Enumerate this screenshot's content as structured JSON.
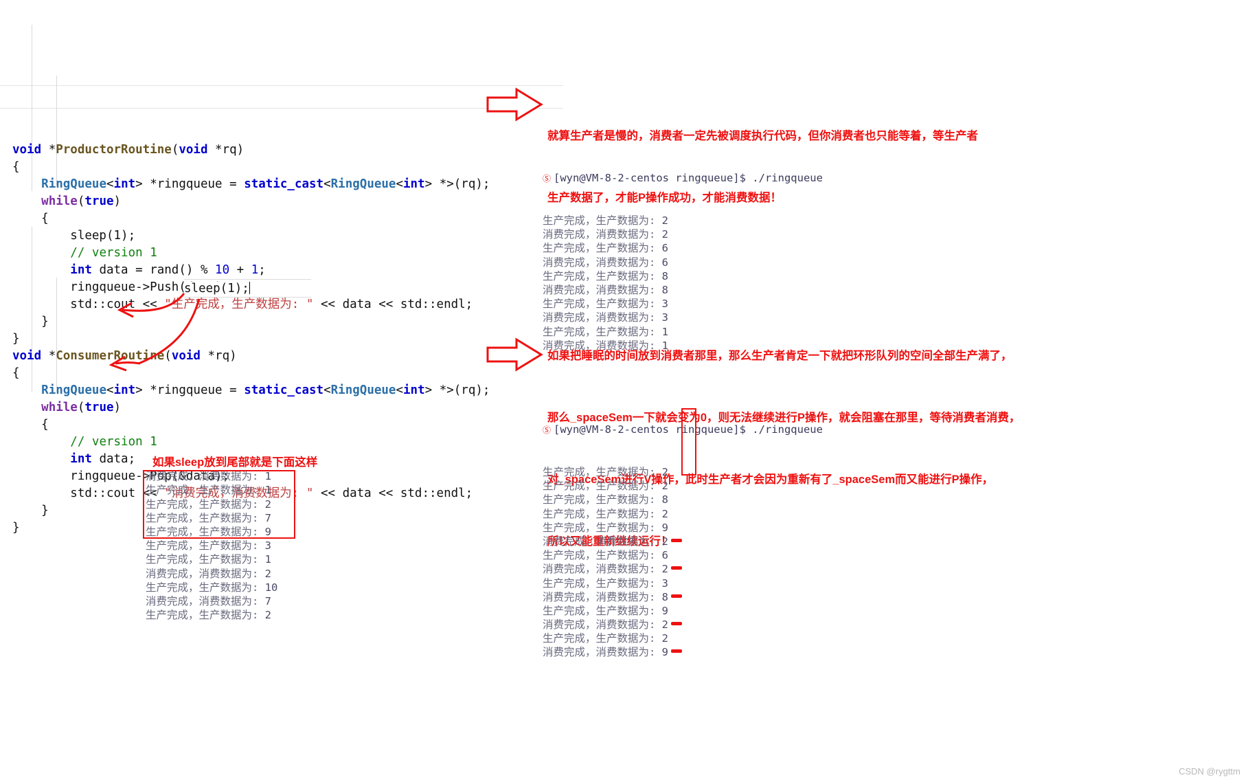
{
  "code": {
    "lines": [
      [
        {
          "t": "void",
          "c": "kw"
        },
        {
          "t": " *",
          "c": "plain"
        },
        {
          "t": "ProductorRoutine",
          "c": "fn"
        },
        {
          "t": "(",
          "c": "plain"
        },
        {
          "t": "void",
          "c": "kw"
        },
        {
          "t": " *rq)",
          "c": "plain"
        }
      ],
      [
        {
          "t": "{",
          "c": "brace"
        }
      ],
      [
        {
          "t": "    ",
          "c": "plain"
        },
        {
          "t": "RingQueue",
          "c": "type"
        },
        {
          "t": "<",
          "c": "plain"
        },
        {
          "t": "int",
          "c": "kw"
        },
        {
          "t": "> *ringqueue = ",
          "c": "plain"
        },
        {
          "t": "static_cast",
          "c": "kw"
        },
        {
          "t": "<",
          "c": "plain"
        },
        {
          "t": "RingQueue",
          "c": "type"
        },
        {
          "t": "<",
          "c": "plain"
        },
        {
          "t": "int",
          "c": "kw"
        },
        {
          "t": "> *>(rq);",
          "c": "plain"
        }
      ],
      [
        {
          "t": "    ",
          "c": "plain"
        },
        {
          "t": "while",
          "c": "kw2"
        },
        {
          "t": "(",
          "c": "plain"
        },
        {
          "t": "true",
          "c": "kw"
        },
        {
          "t": ")",
          "c": "plain"
        }
      ],
      [
        {
          "t": "    {",
          "c": "brace"
        }
      ],
      [
        {
          "t": "        sleep(1);",
          "c": "plain"
        }
      ],
      [
        {
          "t": "        ",
          "c": "plain"
        },
        {
          "t": "// version 1",
          "c": "cmt"
        }
      ],
      [
        {
          "t": "        ",
          "c": "plain"
        },
        {
          "t": "int",
          "c": "kw"
        },
        {
          "t": " data = rand() % ",
          "c": "plain"
        },
        {
          "t": "10",
          "c": "num"
        },
        {
          "t": " + ",
          "c": "plain"
        },
        {
          "t": "1",
          "c": "num"
        },
        {
          "t": ";",
          "c": "plain"
        }
      ],
      [
        {
          "t": "        ringqueue->Push(data);",
          "c": "plain"
        }
      ],
      [
        {
          "t": "        std::cout << ",
          "c": "plain"
        },
        {
          "t": "\"生产完成，生产数据为: \"",
          "c": "str"
        },
        {
          "t": " << data << std::endl;",
          "c": "plain"
        }
      ],
      [
        {
          "t": "    }",
          "c": "brace"
        }
      ],
      [
        {
          "t": "}",
          "c": "brace"
        }
      ],
      [
        {
          "t": "void",
          "c": "kw"
        },
        {
          "t": " *",
          "c": "plain"
        },
        {
          "t": "ConsumerRoutine",
          "c": "fn"
        },
        {
          "t": "(",
          "c": "plain"
        },
        {
          "t": "void",
          "c": "kw"
        },
        {
          "t": " *rq)",
          "c": "plain"
        }
      ],
      [
        {
          "t": "{",
          "c": "brace"
        }
      ],
      [
        {
          "t": "    ",
          "c": "plain"
        },
        {
          "t": "RingQueue",
          "c": "type"
        },
        {
          "t": "<",
          "c": "plain"
        },
        {
          "t": "int",
          "c": "kw"
        },
        {
          "t": "> *ringqueue = ",
          "c": "plain"
        },
        {
          "t": "static_cast",
          "c": "kw"
        },
        {
          "t": "<",
          "c": "plain"
        },
        {
          "t": "RingQueue",
          "c": "type"
        },
        {
          "t": "<",
          "c": "plain"
        },
        {
          "t": "int",
          "c": "kw"
        },
        {
          "t": "> *>(rq);",
          "c": "plain"
        }
      ],
      [
        {
          "t": "    ",
          "c": "plain"
        },
        {
          "t": "while",
          "c": "kw2"
        },
        {
          "t": "(",
          "c": "plain"
        },
        {
          "t": "true",
          "c": "kw"
        },
        {
          "t": ")",
          "c": "plain"
        }
      ],
      [
        {
          "t": "    {",
          "c": "brace"
        }
      ],
      [
        {
          "t": "        ",
          "c": "plain"
        },
        {
          "t": "// version 1",
          "c": "cmt"
        }
      ],
      [
        {
          "t": "        ",
          "c": "plain"
        },
        {
          "t": "int",
          "c": "kw"
        },
        {
          "t": " data;",
          "c": "plain"
        }
      ],
      [
        {
          "t": "        ringqueue->Pop(&data);",
          "c": "plain"
        }
      ],
      [
        {
          "t": "        std::cout << ",
          "c": "plain"
        },
        {
          "t": "\"消费完成，消费数据为: \"",
          "c": "str"
        },
        {
          "t": " << data << std::endl;",
          "c": "plain"
        }
      ],
      [
        {
          "t": "    }",
          "c": "brace"
        }
      ],
      [
        {
          "t": "}",
          "c": "brace"
        }
      ]
    ],
    "floating_sleep": "sleep(1);"
  },
  "annotations": {
    "top_right": [
      "就算生产者是慢的，消费者一定先被调度执行代码，但你消费者也只能等着，等生产者",
      "生产数据了，才能P操作成功，才能消费数据！"
    ],
    "mid_right": [
      "如果把睡眠的时间放到消费者那里，那么生产者肯定一下就把环形队列的空间全部生产满了，",
      "那么_spaceSem一下就会变为0，则无法继续进行P操作，就会阻塞在那里，等待消费者消费，",
      "对_spaceSem进行V操作，此时生产者才会因为重新有了_spaceSem而又能进行P操作，",
      "所以又能重新继续运行！"
    ],
    "bottom_left": "如果sleep放到尾部就是下面这样"
  },
  "terminal_1": {
    "prompt": "[wyn@VM-8-2-centos ringqueue]$ ./ringqueue",
    "lines": [
      {
        "label": "生产完成，生产数据为: ",
        "value": "2"
      },
      {
        "label": "消费完成，消费数据为: ",
        "value": "2"
      },
      {
        "label": "生产完成，生产数据为: ",
        "value": "6"
      },
      {
        "label": "消费完成，消费数据为: ",
        "value": "6"
      },
      {
        "label": "生产完成，生产数据为: ",
        "value": "8"
      },
      {
        "label": "消费完成，消费数据为: ",
        "value": "8"
      },
      {
        "label": "生产完成，生产数据为: ",
        "value": "3"
      },
      {
        "label": "消费完成，消费数据为: ",
        "value": "3"
      },
      {
        "label": "生产完成，生产数据为: ",
        "value": "1"
      },
      {
        "label": "消费完成，消费数据为: ",
        "value": "1"
      }
    ]
  },
  "terminal_2": {
    "prompt": "[wyn@VM-8-2-centos ringqueue]$ ./ringqueue",
    "lines": [
      {
        "label": "生产完成，生产数据为: ",
        "value": "2",
        "boxed": true,
        "dash": false
      },
      {
        "label": "生产完成，生产数据为: ",
        "value": "2",
        "boxed": true,
        "dash": false
      },
      {
        "label": "生产完成，生产数据为: ",
        "value": "8",
        "boxed": true,
        "dash": false
      },
      {
        "label": "生产完成，生产数据为: ",
        "value": "2",
        "boxed": true,
        "dash": false
      },
      {
        "label": "生产完成，生产数据为: ",
        "value": "9",
        "boxed": true,
        "dash": false
      },
      {
        "label": "消费完成，消费数据为: ",
        "value": "2",
        "boxed": false,
        "dash": true
      },
      {
        "label": "生产完成，生产数据为: ",
        "value": "6",
        "boxed": false,
        "dash": false
      },
      {
        "label": "消费完成，消费数据为: ",
        "value": "2",
        "boxed": false,
        "dash": true
      },
      {
        "label": "生产完成，生产数据为: ",
        "value": "3",
        "boxed": false,
        "dash": false
      },
      {
        "label": "消费完成，消费数据为: ",
        "value": "8",
        "boxed": false,
        "dash": true
      },
      {
        "label": "生产完成，生产数据为: ",
        "value": "9",
        "boxed": false,
        "dash": false
      },
      {
        "label": "消费完成，消费数据为: ",
        "value": "2",
        "boxed": false,
        "dash": true
      },
      {
        "label": "生产完成，生产数据为: ",
        "value": "2",
        "boxed": false,
        "dash": false
      },
      {
        "label": "消费完成，消费数据为: ",
        "value": "9",
        "boxed": false,
        "dash": true
      }
    ]
  },
  "terminal_3": {
    "lines": [
      {
        "label": "消费完成，消费数据为: ",
        "value": "1",
        "boxed": false
      },
      {
        "label": "生产完成，生产数据为: ",
        "value": "1",
        "boxed": false
      },
      {
        "label": "生产完成，生产数据为: ",
        "value": "2",
        "boxed": true
      },
      {
        "label": "生产完成，生产数据为: ",
        "value": "7",
        "boxed": true
      },
      {
        "label": "生产完成，生产数据为: ",
        "value": "9",
        "boxed": true
      },
      {
        "label": "生产完成，生产数据为: ",
        "value": "3",
        "boxed": true
      },
      {
        "label": "生产完成，生产数据为: ",
        "value": "1",
        "boxed": true
      },
      {
        "label": "消费完成，消费数据为: ",
        "value": "2",
        "boxed": false
      },
      {
        "label": "生产完成，生产数据为: ",
        "value": "10",
        "boxed": false
      },
      {
        "label": "消费完成，消费数据为: ",
        "value": "7",
        "boxed": false
      },
      {
        "label": "生产完成，生产数据为: ",
        "value": "2",
        "boxed": false
      }
    ]
  },
  "watermark": "CSDN @rygttm",
  "colors": {
    "annotation_red": "#ee1111",
    "terminal_text": "#6b6b80",
    "keyword_blue": "#0000cd",
    "string_red": "#c04040",
    "comment_green": "#108010"
  }
}
